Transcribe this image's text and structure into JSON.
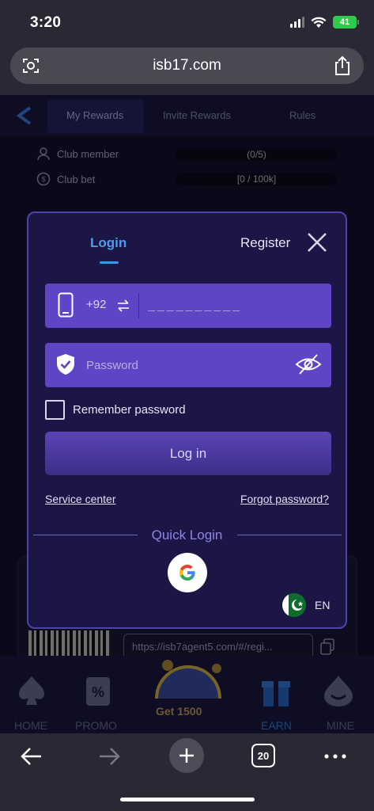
{
  "status": {
    "time": "3:20",
    "battery": "41"
  },
  "browser": {
    "url": "isb17.com",
    "tabs_count": "20"
  },
  "background_page": {
    "tabs": [
      "My Rewards",
      "Invite Rewards",
      "Rules"
    ],
    "rows": [
      {
        "label": "Club member",
        "value": "(0/5)"
      },
      {
        "label": "Club bet",
        "value": "[0 / 100k]"
      }
    ],
    "referral_link": "https://isb7agent5.com/#/regi...",
    "nav": [
      "HOME",
      "PROMO",
      "Get 1500",
      "EARN",
      "MINE"
    ]
  },
  "modal": {
    "login_tab": "Login",
    "register_tab": "Register",
    "country_code": "+92",
    "phone_placeholder": "__________",
    "password_placeholder": "Password",
    "remember_label": "Remember password",
    "login_button": "Log in",
    "service_center": "Service center",
    "forgot_password": "Forgot password?",
    "quick_login": "Quick Login",
    "language": "EN"
  },
  "colors": {
    "accent_blue": "#4a9cf0",
    "field_purple": "#5f45c6",
    "modal_bg": "#1c1646",
    "modal_border": "#4d42a8"
  }
}
